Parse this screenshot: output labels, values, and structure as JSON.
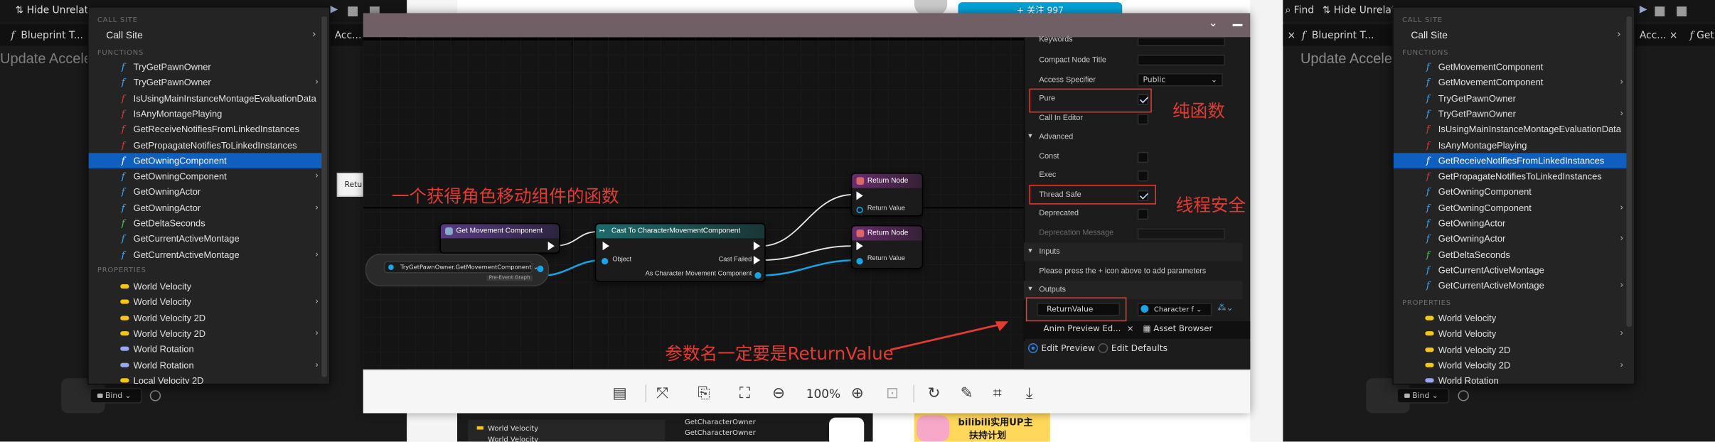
{
  "left_editor": {
    "toolbar": {
      "hide_unrelated": "Hide Unrelate"
    },
    "tab": {
      "label": "Blueprint T...",
      "label2": "Acc..."
    },
    "title": "Update Accelera",
    "bind_label": "Bind",
    "menu": {
      "call_site_header": "CALL SITE",
      "call_site": "Call Site",
      "functions_header": "FUNCTIONS",
      "functions": [
        {
          "label": "TryGetPawnOwner",
          "icon": "function-icon",
          "color": "#3fa6f2",
          "submenu": false,
          "selected": false
        },
        {
          "label": "TryGetPawnOwner",
          "icon": "function-icon",
          "color": "#3fa6f2",
          "submenu": true,
          "selected": false
        },
        {
          "label": "IsUsingMainInstanceMontageEvaluationData",
          "icon": "function-icon",
          "color": "#d13b3b",
          "submenu": false,
          "selected": false
        },
        {
          "label": "IsAnyMontagePlaying",
          "icon": "function-icon",
          "color": "#d13b3b",
          "submenu": false,
          "selected": false
        },
        {
          "label": "GetReceiveNotifiesFromLinkedInstances",
          "icon": "function-icon",
          "color": "#d13b3b",
          "submenu": false,
          "selected": false
        },
        {
          "label": "GetPropagateNotifiesToLinkedInstances",
          "icon": "function-icon",
          "color": "#d13b3b",
          "submenu": false,
          "selected": false
        },
        {
          "label": "GetOwningComponent",
          "icon": "function-icon",
          "color": "#3fa6f2",
          "submenu": false,
          "selected": true
        },
        {
          "label": "GetOwningComponent",
          "icon": "function-icon",
          "color": "#3fa6f2",
          "submenu": true,
          "selected": false
        },
        {
          "label": "GetOwningActor",
          "icon": "function-icon",
          "color": "#3fa6f2",
          "submenu": false,
          "selected": false
        },
        {
          "label": "GetOwningActor",
          "icon": "function-icon",
          "color": "#3fa6f2",
          "submenu": true,
          "selected": false
        },
        {
          "label": "GetDeltaSeconds",
          "icon": "function-icon",
          "color": "#4ec04e",
          "submenu": false,
          "selected": false
        },
        {
          "label": "GetCurrentActiveMontage",
          "icon": "function-icon",
          "color": "#3fa6f2",
          "submenu": false,
          "selected": false
        },
        {
          "label": "GetCurrentActiveMontage",
          "icon": "function-icon",
          "color": "#3fa6f2",
          "submenu": true,
          "selected": false
        }
      ],
      "properties_header": "PROPERTIES",
      "properties": [
        {
          "label": "World Velocity",
          "color": "#f5c518",
          "submenu": false
        },
        {
          "label": "World Velocity",
          "color": "#f5c518",
          "submenu": true
        },
        {
          "label": "World Velocity 2D",
          "color": "#f5c518",
          "submenu": false
        },
        {
          "label": "World Velocity 2D",
          "color": "#f5c518",
          "submenu": true
        },
        {
          "label": "World Rotation",
          "color": "#9aa6f0",
          "submenu": false
        },
        {
          "label": "World Rotation",
          "color": "#9aa6f0",
          "submenu": true
        },
        {
          "label": "Local Velocity 2D",
          "color": "#f5c518",
          "submenu": false
        }
      ]
    },
    "tooltip_partial": "Retu"
  },
  "viewer": {
    "graph": {
      "node_get_movement": "Get Movement Component",
      "node_cast": "Cast To CharacterMovementComponent",
      "pin_object": "Object",
      "pin_cast_failed": "Cast Failed",
      "pin_as_cmc": "As Character Movement Component",
      "return_node_1": "Return Node",
      "return_node_2": "Return Node",
      "return_value_1": "Return Value",
      "return_value_2": "Return Value",
      "var_node": "TryGetPawnOwner.GetMovementComponent",
      "var_badge": "Pre-Event Graph",
      "annotation_title": "一个获得角色移动组件的函数"
    },
    "details": {
      "keywords": "Keywords",
      "compact_node_title": "Compact Node Title",
      "access_specifier": "Access Specifier",
      "access_value": "Public",
      "pure": "Pure",
      "call_in_editor": "Call In Editor",
      "advanced": "Advanced",
      "const": "Const",
      "exec": "Exec",
      "thread_safe": "Thread Safe",
      "deprecated": "Deprecated",
      "deprecation_message": "Deprecation Message",
      "inputs": "Inputs",
      "inputs_hint": "Please press the + icon above to add parameters",
      "outputs": "Outputs",
      "output_name": "ReturnValue",
      "output_type": "Character f",
      "tab_anim_preview": "Anim Preview Ed...",
      "tab_asset_browser": "Asset Browser",
      "edit_preview": "Edit Preview",
      "edit_defaults": "Edit Defaults"
    },
    "annotations": {
      "pure": "纯函数",
      "thread_safe": "线程安全",
      "return_value": "参数名一定要是ReturnValue"
    },
    "zoom": "100%"
  },
  "web": {
    "follow_button": "+ 关注 997",
    "banner_line1": "bilibili实用UP主",
    "banner_line2": "扶持计划",
    "bottom_items": [
      "World Velocity",
      "World Velocity"
    ],
    "bottom_right_items": [
      "GetCharacterOwner",
      "GetCharacterOwner"
    ]
  },
  "right_editor": {
    "toolbar": {
      "find": "Find",
      "hide_unrelated": "Hide Unrelate"
    },
    "tab": {
      "label": "Blueprint T...",
      "label2": "Acc...",
      "label3": "Get"
    },
    "title": "Update Accelera",
    "bind_label": "Bind",
    "menu": {
      "call_site_header": "CALL SITE",
      "call_site": "Call Site",
      "functions_header": "FUNCTIONS",
      "functions": [
        {
          "label": "GetMovementComponent",
          "color": "#3fa6f2",
          "submenu": false,
          "selected": false
        },
        {
          "label": "GetMovementComponent",
          "color": "#3fa6f2",
          "submenu": true,
          "selected": false
        },
        {
          "label": "TryGetPawnOwner",
          "color": "#3fa6f2",
          "submenu": false,
          "selected": false
        },
        {
          "label": "TryGetPawnOwner",
          "color": "#3fa6f2",
          "submenu": true,
          "selected": false
        },
        {
          "label": "IsUsingMainInstanceMontageEvaluationData",
          "color": "#d13b3b",
          "submenu": false,
          "selected": false
        },
        {
          "label": "IsAnyMontagePlaying",
          "color": "#d13b3b",
          "submenu": false,
          "selected": false
        },
        {
          "label": "GetReceiveNotifiesFromLinkedInstances",
          "color": "#d13b3b",
          "submenu": false,
          "selected": true
        },
        {
          "label": "GetPropagateNotifiesToLinkedInstances",
          "color": "#d13b3b",
          "submenu": false,
          "selected": false
        },
        {
          "label": "GetOwningComponent",
          "color": "#3fa6f2",
          "submenu": false,
          "selected": false
        },
        {
          "label": "GetOwningComponent",
          "color": "#3fa6f2",
          "submenu": true,
          "selected": false
        },
        {
          "label": "GetOwningActor",
          "color": "#3fa6f2",
          "submenu": false,
          "selected": false
        },
        {
          "label": "GetOwningActor",
          "color": "#3fa6f2",
          "submenu": true,
          "selected": false
        },
        {
          "label": "GetDeltaSeconds",
          "color": "#4ec04e",
          "submenu": false,
          "selected": false
        },
        {
          "label": "GetCurrentActiveMontage",
          "color": "#3fa6f2",
          "submenu": false,
          "selected": false
        },
        {
          "label": "GetCurrentActiveMontage",
          "color": "#3fa6f2",
          "submenu": true,
          "selected": false
        }
      ],
      "properties_header": "PROPERTIES",
      "properties": [
        {
          "label": "World Velocity",
          "color": "#f5c518",
          "submenu": false
        },
        {
          "label": "World Velocity",
          "color": "#f5c518",
          "submenu": true
        },
        {
          "label": "World Velocity 2D",
          "color": "#f5c518",
          "submenu": false
        },
        {
          "label": "World Velocity 2D",
          "color": "#f5c518",
          "submenu": true
        },
        {
          "label": "World Rotation",
          "color": "#9aa6f0",
          "submenu": false
        }
      ]
    }
  }
}
